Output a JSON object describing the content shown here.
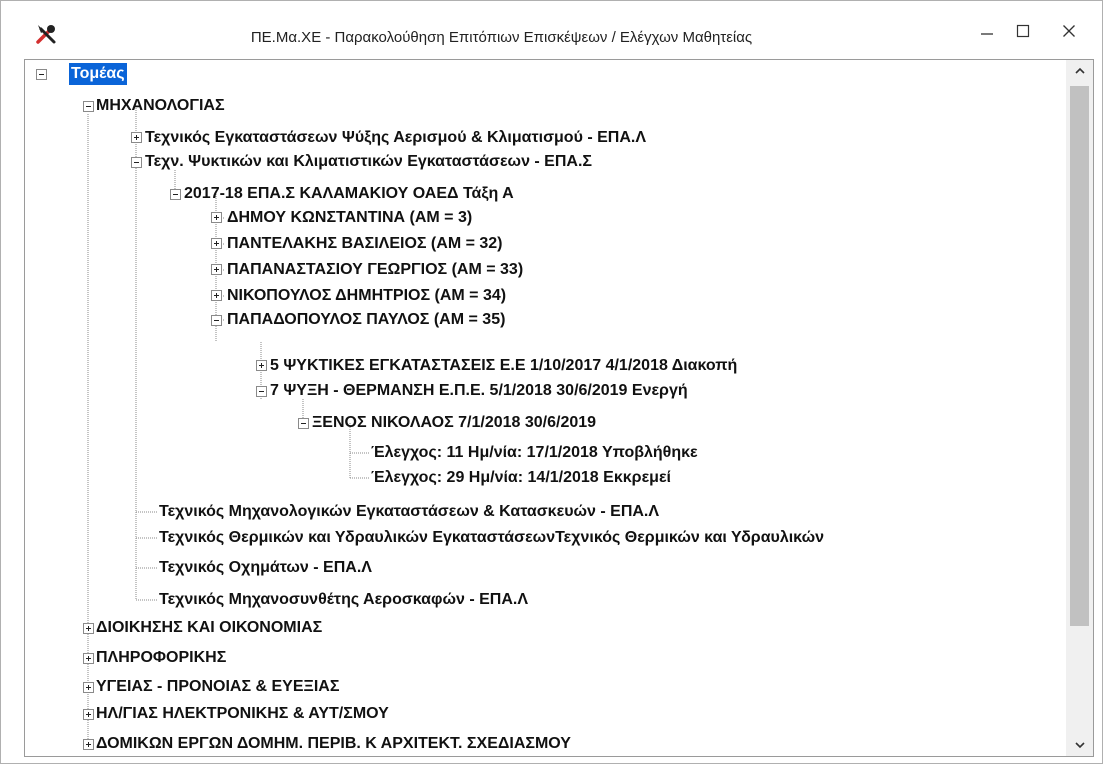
{
  "window": {
    "title": "ΠΕ.Μα.ΧΕ - Παρακολούθηση Επιτόπιων Επισκέψεων / Ελέγχων Μαθητείας",
    "app_icon": "tools-icon",
    "minimize_icon": "minimize-icon",
    "maximize_icon": "maximize-icon",
    "close_icon": "close-icon"
  },
  "tree": {
    "root": "Τομέας",
    "mechanical": "ΜΗΧΑΝΟΛΟΓΙΑΣ",
    "spec_cooling_epal": "Τεχνικός Εγκαταστάσεων Ψύξης Αερισμού & Κλιματισμού - ΕΠΑ.Λ",
    "spec_cooling_epas": "Τεχν. Ψυκτικών και Κλιματιστικών Εγκαταστάσεων - ΕΠΑ.Σ",
    "class_2017": "2017-18  ΕΠΑ.Σ ΚΑΛΑΜΑΚΙΟΥ  ΟΑΕΔ  Τάξη Α",
    "students": [
      "ΔΗΜΟΥ  ΚΩΝΣΤΑΝΤΙΝΑ (ΑΜ = 3)",
      "ΠΑΝΤΕΛΑΚΗΣ  ΒΑΣΙΛΕΙΟΣ (ΑΜ = 32)",
      "ΠΑΠΑΝΑΣΤΑΣΙΟΥ  ΓΕΩΡΓΙΟΣ (ΑΜ = 33)",
      "ΝΙΚΟΠΟΥΛΟΣ  ΔΗΜΗΤΡΙΟΣ (ΑΜ = 34)",
      "ΠΑΠΑΔΟΠΟΥΛΟΣ  ΠΑΥΛΟΣ (ΑΜ = 35)"
    ],
    "placement_5": "5   ΨΥΚΤΙΚΕΣ ΕΓΚΑΤΑΣΤΑΣΕΙΣ Ε.Ε   1/10/2017   4/1/2018   Διακοπή",
    "placement_7": "7   ΨΥΞΗ - ΘΕΡΜΑΝΣΗ Ε.Π.Ε.   5/1/2018   30/6/2019   Ενεργή",
    "supervisor": "ΞΕΝΟΣ  ΝΙΚΟΛΑΟΣ   7/1/2018   30/6/2019",
    "inspections": [
      "Έλεγχος: 11 Ημ/νία: 17/1/2018   Υποβλήθηκε",
      "Έλεγχος: 29 Ημ/νία: 14/1/2018   Εκκρεμεί"
    ],
    "other_specialties": [
      "Τεχνικός Μηχανολογικών Εγκαταστάσεων & Κατασκευών - ΕΠΑ.Λ",
      "Τεχνικός Θερμικών και Υδραυλικών ΕγκαταστάσεωνΤεχνικός Θερμικών και Υδραυλικών",
      "Τεχνικός Οχημάτων - ΕΠΑ.Λ",
      "Τεχνικός Μηχανοσυνθέτης Αεροσκαφών - ΕΠΑ.Λ"
    ],
    "sectors": [
      "ΔΙΟΙΚΗΣΗΣ ΚΑΙ ΟΙΚΟΝΟΜΙΑΣ",
      "ΠΛΗΡΟΦΟΡΙΚΗΣ",
      "ΥΓΕΙΑΣ - ΠΡΟΝΟΙΑΣ & ΕΥΕΞΙΑΣ",
      "ΗΛ/ΓΙΑΣ ΗΛΕΚΤΡΟΝΙΚΗΣ & ΑΥΤ/ΣΜΟΥ",
      "ΔΟΜΙΚΩΝ ΕΡΓΩΝ ΔΟΜΗΜ. ΠΕΡΙΒ. Κ ΑΡΧΙΤΕΚΤ. ΣΧΕΔΙΑΣΜΟΥ"
    ]
  },
  "colors": {
    "selection": "#0a64d8",
    "close_icon_accent": "#d32f2f"
  }
}
